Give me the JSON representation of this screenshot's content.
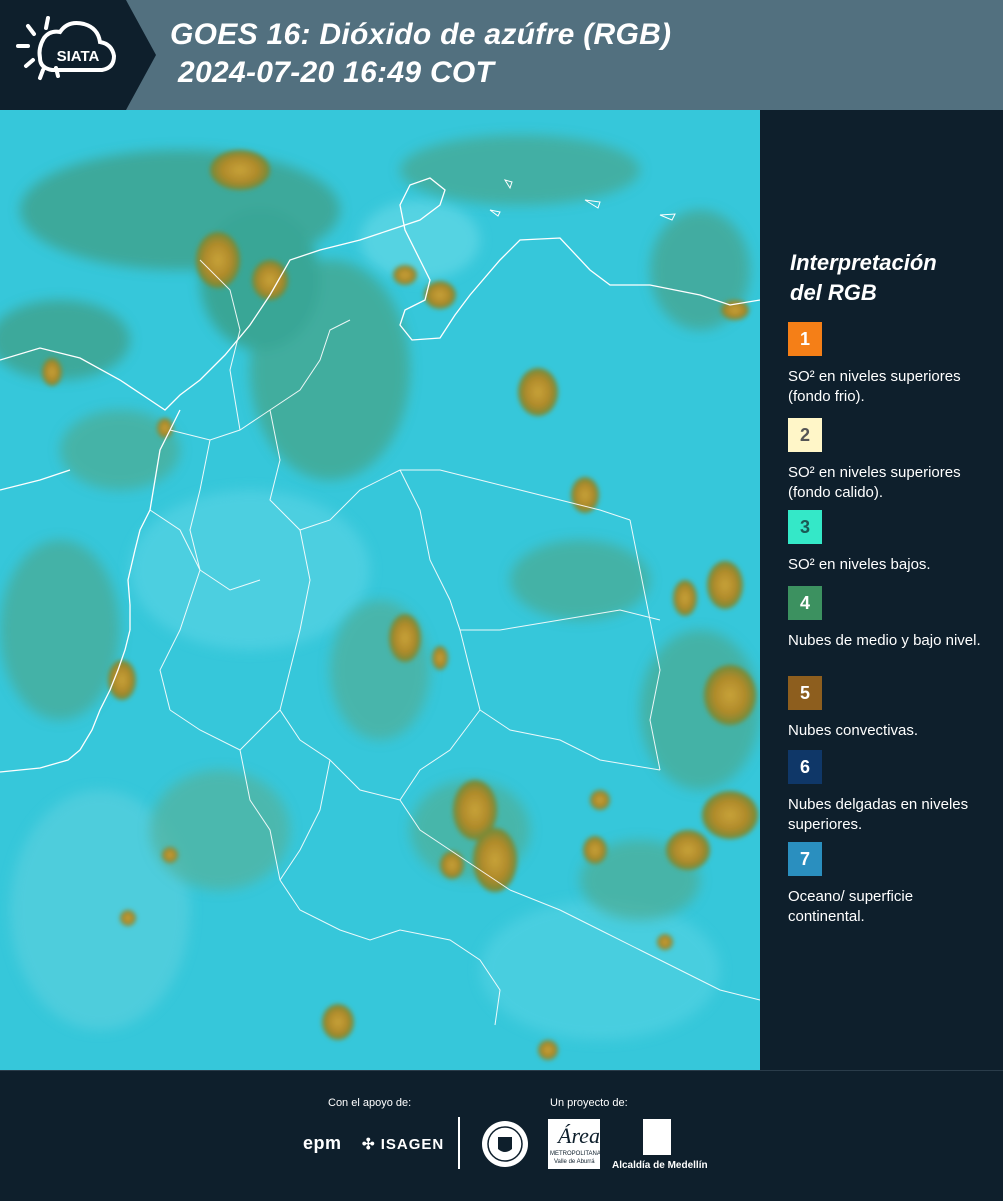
{
  "header": {
    "logo_text": "SIATA",
    "title_line1": "GOES 16: Dióxido de azúfre (RGB)",
    "title_line2": "2024-07-20 16:49 COT"
  },
  "legend": {
    "title_line1": "Interpretación",
    "title_line2": "del RGB",
    "items": [
      {
        "number": "1",
        "color": "#f57f17",
        "text": "SO² en niveles superiores (fondo frio)."
      },
      {
        "number": "2",
        "color": "#fff6c8",
        "text": "SO² en niveles superiores (fondo calido)."
      },
      {
        "number": "3",
        "color": "#34e8c8",
        "text": "SO² en niveles bajos."
      },
      {
        "number": "4",
        "color": "#3c9160",
        "text": "Nubes de medio y bajo nivel."
      },
      {
        "number": "5",
        "color": "#8d5e1e",
        "text": "Nubes convectivas."
      },
      {
        "number": "6",
        "color": "#0f3768",
        "text": "Nubes delgadas en niveles superiores."
      },
      {
        "number": "7",
        "color": "#2a8fbf",
        "text": "Oceano/ superficie continental."
      }
    ]
  },
  "footer": {
    "support_label": "Con el apoyo de:",
    "project_label": "Un proyecto de:",
    "sponsor1": "epm",
    "sponsor2": "ISAGEN",
    "partner_area": "Área",
    "partner_area_sub1": "METROPOLITANA",
    "partner_area_sub2": "Valle de Aburrá",
    "partner_alcaldia": "Alcaldía de Medellín"
  }
}
